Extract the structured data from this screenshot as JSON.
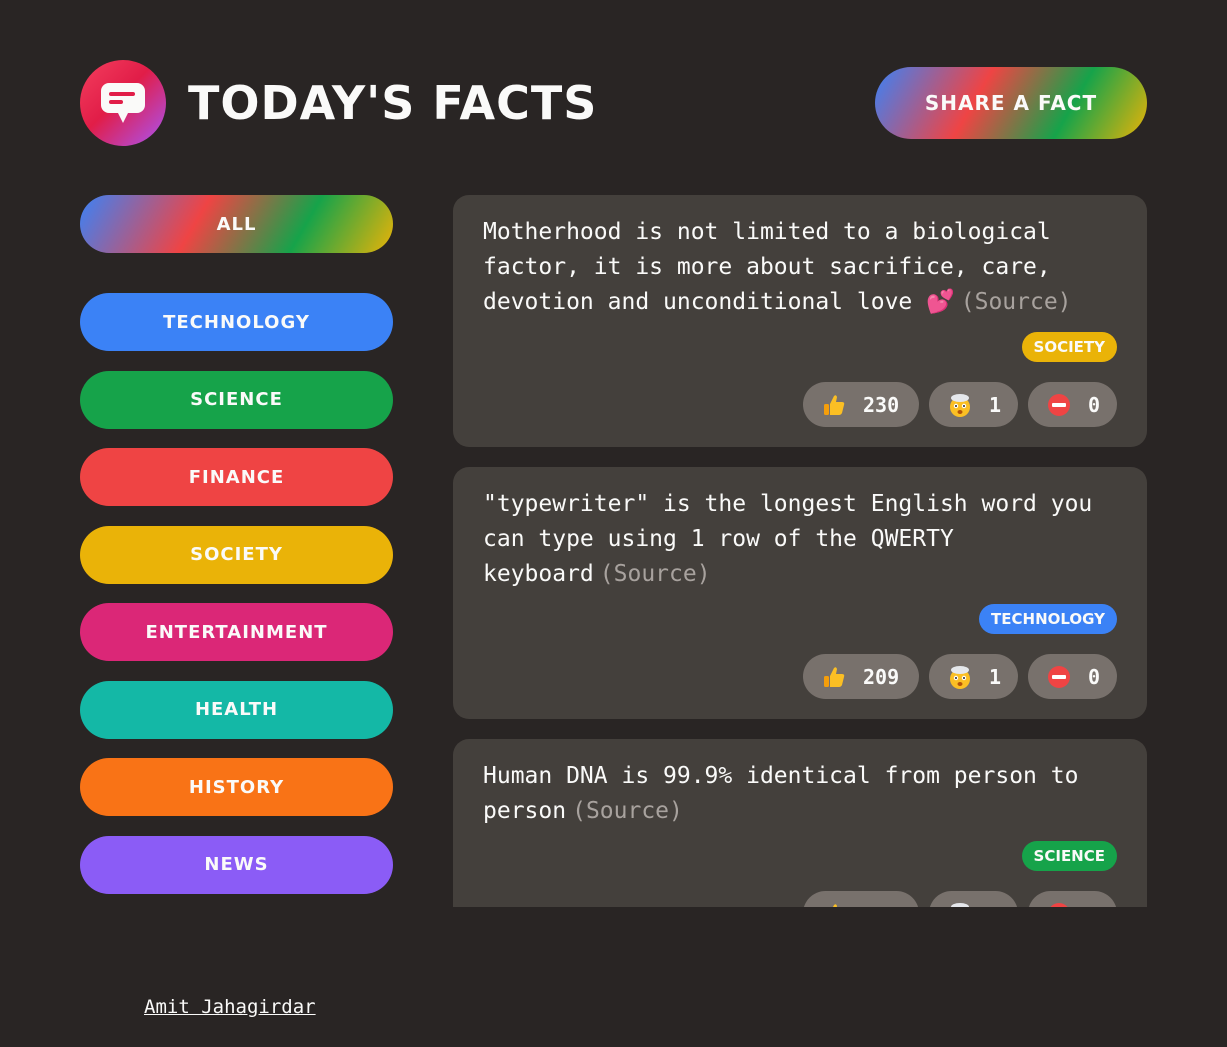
{
  "header": {
    "title": "TODAY'S FACTS",
    "share_label": "SHARE A FACT",
    "logo_icon": "speech-bubble-icon"
  },
  "sidebar": {
    "items": [
      {
        "label": "ALL",
        "color": "gradient"
      },
      {
        "label": "TECHNOLOGY",
        "color": "#3b82f6"
      },
      {
        "label": "SCIENCE",
        "color": "#16a34a"
      },
      {
        "label": "FINANCE",
        "color": "#ef4444"
      },
      {
        "label": "SOCIETY",
        "color": "#eab308"
      },
      {
        "label": "ENTERTAINMENT",
        "color": "#db2777"
      },
      {
        "label": "HEALTH",
        "color": "#14b8a6"
      },
      {
        "label": "HISTORY",
        "color": "#f97316"
      },
      {
        "label": "NEWS",
        "color": "#8b5cf6"
      }
    ]
  },
  "facts": [
    {
      "text": "Motherhood is not limited to a biological factor, it is more about sacrifice, care, devotion and unconditional love 💕",
      "source": "(Source)",
      "category": "SOCIETY",
      "category_color": "#eab308",
      "likes": "230",
      "mindblowing": "1",
      "false": "0"
    },
    {
      "text": "\"typewriter\" is the longest English word you can type using 1 row of the QWERTY keyboard",
      "source": "(Source)",
      "category": "TECHNOLOGY",
      "category_color": "#3b82f6",
      "likes": "209",
      "mindblowing": "1",
      "false": "0"
    },
    {
      "text": "Human DNA is 99.9% identical from person to person",
      "source": "(Source)",
      "category": "SCIENCE",
      "category_color": "#16a34a",
      "likes": "",
      "mindblowing": "",
      "false": ""
    }
  ],
  "footer": {
    "author": "Amit Jahagirdar"
  }
}
